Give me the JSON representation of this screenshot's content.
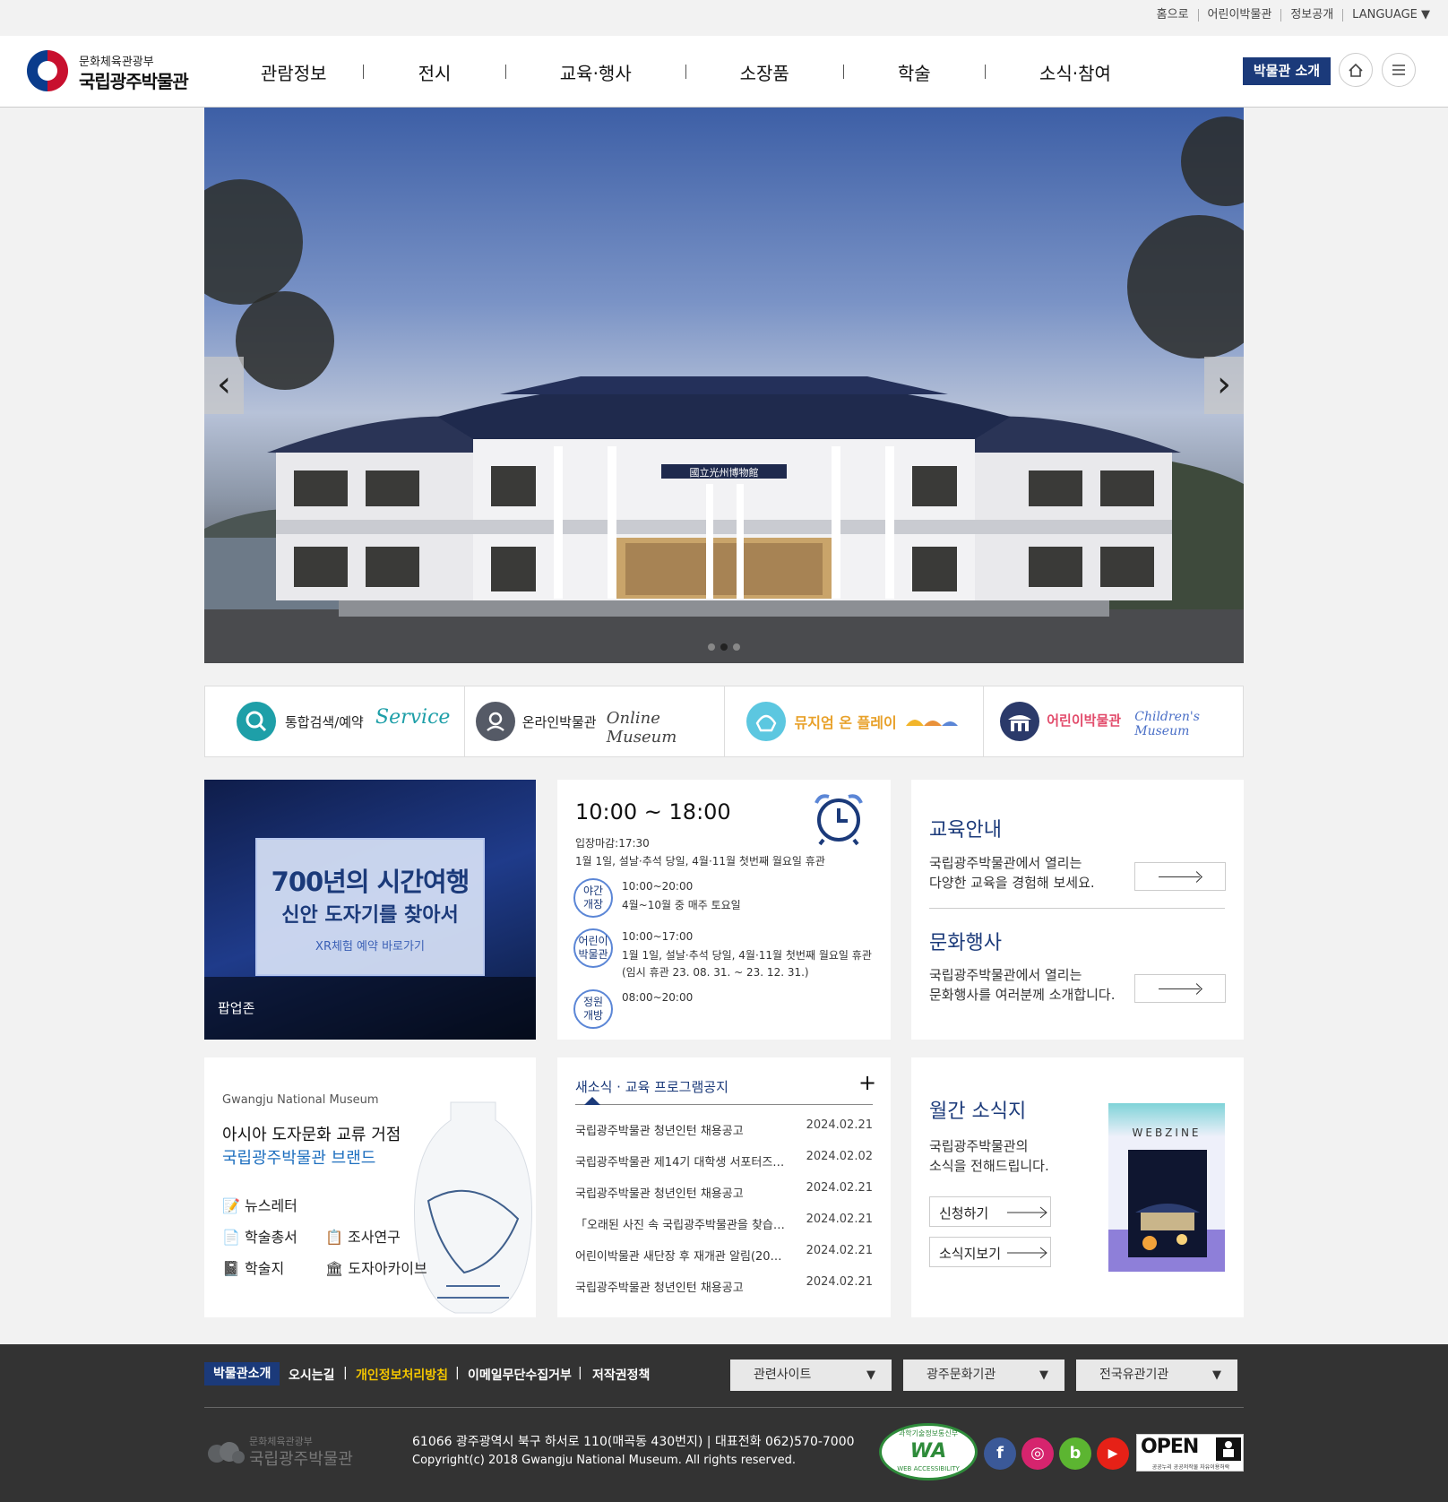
{
  "util_links": [
    "홈으로",
    "어린이박물관",
    "정보공개",
    "LANGUAGE ▼"
  ],
  "logo": {
    "ministry": "문화체육관광부",
    "name": "국립광주박물관"
  },
  "gnb": [
    "관람정보",
    "전시",
    "교육·행사",
    "소장품",
    "학술",
    "소식·참여"
  ],
  "header_button": "박물관 소개",
  "hero": {
    "sign": "國立光州博物館",
    "prev_icon": "chevron-left-icon",
    "next_icon": "chevron-right-icon",
    "active_slide": 2,
    "slide_count": 3
  },
  "quick": [
    {
      "icon": "search-icon",
      "label": "통합검색/예약",
      "script": "Service",
      "color": "#1e9fa8"
    },
    {
      "icon": "location-icon",
      "label": "온라인박물관",
      "script": "Online Museum",
      "color": "#555a66"
    },
    {
      "icon": "shell-icon",
      "label": "뮤지엄 온 플레이",
      "script": "",
      "color": "#5cc7e0"
    },
    {
      "icon": "museum-building-icon",
      "label": "어린이박물관",
      "script": "Children's Museum",
      "color": "#2b3a6a"
    }
  ],
  "popup": {
    "title": "700년의 시간여행",
    "subtitle": "신안 도자기를 찾아서",
    "link": "XR체험 예약 바로가기",
    "caption": "팝업존"
  },
  "hours": {
    "main": "10:00 ~ 18:00",
    "last_entry": "입장마감:17:30",
    "closed": "1월 1일, 설날·추석 당일, 4월·11월 첫번째 월요일 휴관",
    "night": {
      "badge_l1": "야간",
      "badge_l2": "개장",
      "time": "10:00~20:00",
      "desc": "4월~10월 중 매주 토요일"
    },
    "kids": {
      "badge_l1": "어린이",
      "badge_l2": "박물관",
      "time": "10:00~17:00",
      "desc": "1월 1일, 설날·추석 당일, 4월·11월 첫번째 월요일 휴관",
      "note": "(임시 휴관 23. 08. 31. ~ 23. 12. 31.)"
    },
    "garden": {
      "badge_l1": "정원",
      "badge_l2": "개방",
      "time": "08:00~20:00"
    }
  },
  "edu": {
    "title1": "교육안내",
    "desc1_l1": "국립광주박물관에서 열리는",
    "desc1_l2": "다양한 교육을 경험해 보세요.",
    "title2": "문화행사",
    "desc2_l1": "국립광주박물관에서 열리는",
    "desc2_l2": "문화행사를 여러분께 소개합니다."
  },
  "brand": {
    "eng": "Gwangju National Museum",
    "title": "아시아 도자문화 교류 거점",
    "subtitle": "국립광주박물관 브랜드",
    "links": [
      "뉴스레터",
      "학술총서",
      "조사연구",
      "학술지",
      "도자아카이브"
    ]
  },
  "news": {
    "tab": "새소식 · 교육 프로그램공지",
    "more": "+",
    "items": [
      {
        "title": "국립광주박물관 청년인턴 채용공고",
        "date": "2024.02.21"
      },
      {
        "title": "국립광주박물관 제14기 대학생 서포터즈…",
        "date": "2024.02.02"
      },
      {
        "title": "국립광주박물관 청년인턴 채용공고",
        "date": "2024.02.21"
      },
      {
        "title": "「오래된 사진 속 국립광주박물관을 찾습…",
        "date": "2024.02.21"
      },
      {
        "title": "어린이박물관 새단장 후 재개관 알림(20…",
        "date": "2024.02.21"
      },
      {
        "title": "국립광주박물관 청년인턴 채용공고",
        "date": "2024.02.21"
      }
    ]
  },
  "webzine": {
    "title": "월간 소식지",
    "desc_l1": "국립광주박물관의",
    "desc_l2": "소식을 전해드립니다.",
    "subscribe": "신청하기",
    "view": "소식지보기",
    "cover": "WEBZINE"
  },
  "footer": {
    "links": [
      "박물관소개",
      "오시는길",
      "개인정보처리방침",
      "이메일무단수집거부",
      "저작권정책"
    ],
    "highlight_color": "#f3c500",
    "selects": [
      "관련사이트",
      "광주문화기관",
      "전국유관기관"
    ],
    "logo_ministry": "문화체육관광부",
    "logo_name": "국립광주박물관",
    "address": "61066 광주광역시 북구 하서로 110(매곡동 430번지) | 대표전화 062)570-7000",
    "copyright": "Copyright(c) 2018 Gwangju National Museum. All rights reserved.",
    "wa_top": "과학기술정보통신부",
    "wa_mark": "WA",
    "wa_bottom": "WEB ACCESSIBILITY",
    "open_mark": "OPEN",
    "open_caption": "공공누리 공공저작물 자유이용허락",
    "social": [
      {
        "icon": "facebook-icon",
        "glyph": "f",
        "color": "#3b5998"
      },
      {
        "icon": "instagram-icon",
        "glyph": "◎",
        "color": "#d6246e"
      },
      {
        "icon": "blog-icon",
        "glyph": "b",
        "color": "#5cb531"
      },
      {
        "icon": "youtube-icon",
        "glyph": "▶",
        "color": "#e62117"
      }
    ]
  }
}
